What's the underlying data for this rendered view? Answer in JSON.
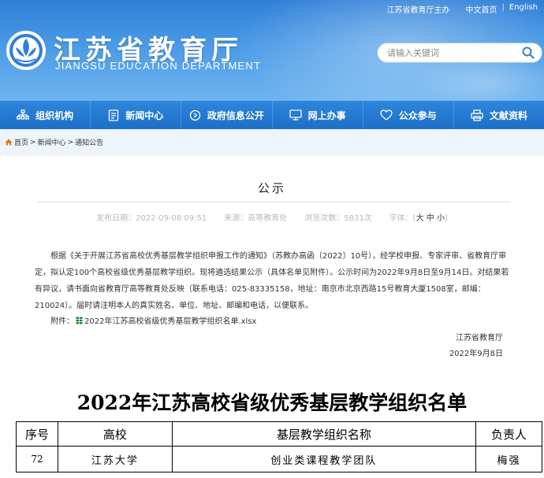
{
  "header": {
    "top_links": [
      "江苏省教育厅主办",
      "中文首页",
      "English"
    ],
    "title": "江苏省教育厅",
    "subtitle": "JIANGSU EDUCATION DEPARTMENT",
    "search_placeholder": "请输入关键词",
    "colors": {
      "header_blue": "#3a8ce0",
      "nav_blue": "#1d6fc6"
    }
  },
  "nav": {
    "items": [
      {
        "label": "组织机构",
        "icon": "org-chart-icon"
      },
      {
        "label": "新闻中心",
        "icon": "document-icon"
      },
      {
        "label": "政府信息公开",
        "icon": "info-circle-icon"
      },
      {
        "label": "网上办事",
        "icon": "monitor-icon"
      },
      {
        "label": "公众参与",
        "icon": "heart-icon"
      },
      {
        "label": "文献资料",
        "icon": "printer-icon"
      }
    ]
  },
  "breadcrumb": {
    "home": "首页",
    "sep": ">",
    "section": "新闻中心",
    "current": "通知公告"
  },
  "article": {
    "title": "公示",
    "meta": {
      "date": "发布日期：2022-09-08 09:51",
      "source": "来源：高等教育处",
      "views": "浏览次数：5831次",
      "font_label": "字体：[",
      "font_big": "大",
      "font_mid": "中",
      "font_small": "小",
      "font_end": "]"
    },
    "body": "根据《关于开展江苏省高校优秀基层教学组织申报工作的通知》（苏教办高函〔2022〕10号），经学校申报、专家评审、省教育厅审定，拟认定100个高校省级优秀基层教学组织。现将遴选结果公示（具体名单见附件）。公示时间为2022年9月8日至9月14日。对结果若有异议，请书面向省教育厅高等教育处反映（联系电话：025-83335158，地址：南京市北京西路15号教育大厦1508室，邮编：210024）。届时请注明本人的真实姓名、单位、地址、邮编和电话，以便联系。",
    "attachment_label": "附件：",
    "attachment_file": "2022年江苏高校省级优秀基层教学组织名单.xlsx",
    "sign_org": "江苏省教育厅",
    "sign_date": "2022年9月8日"
  },
  "document": {
    "title": "2022年江苏高校省级优秀基层教学组织名单",
    "columns": [
      "序号",
      "高校",
      "基层教学组织名称",
      "负责人"
    ],
    "rows": [
      [
        "72",
        "江苏大学",
        "创业类课程教学团队",
        "梅强"
      ]
    ]
  }
}
